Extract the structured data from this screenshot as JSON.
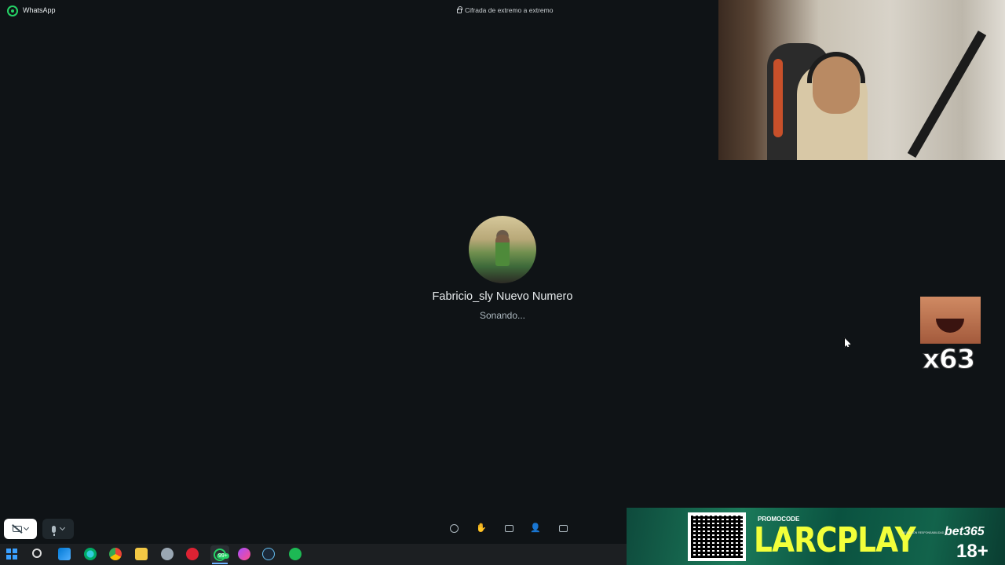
{
  "window": {
    "app_name": "WhatsApp",
    "encryption_label": "Cifrada de extremo a extremo"
  },
  "call": {
    "contact_name": "Fabricio_sly Nuevo Numero",
    "status": "Sonando..."
  },
  "controls": {
    "items": [
      "video-toggle",
      "mic-toggle",
      "emoji",
      "raise-hand",
      "share-screen",
      "add-participant",
      "chat"
    ]
  },
  "overlay": {
    "emote_count": "x63"
  },
  "banner": {
    "promo_label": "PROMOCODE",
    "promo_code": "LARCPLAY",
    "brand": "bet365",
    "age": "18+",
    "disclaimer": "JUEGA CON RESPONSABILIDAD"
  },
  "taskbar": {
    "whatsapp_badge": "99+"
  },
  "colors": {
    "background": "#0f1316",
    "whatsapp_green": "#25d366",
    "promo_yellow": "#f2ff3a"
  }
}
